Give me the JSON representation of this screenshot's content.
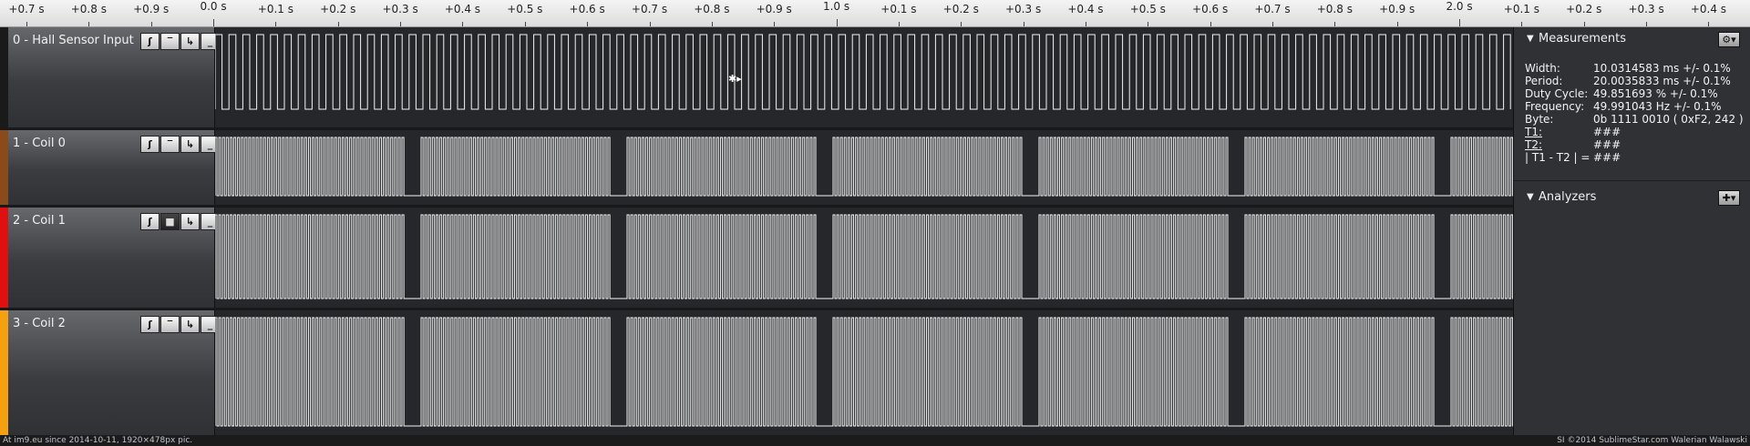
{
  "ruler": {
    "ticks": [
      "+0.7 s",
      "+0.8 s",
      "+0.9 s",
      "0.0 s",
      "+0.1 s",
      "+0.2 s",
      "+0.3 s",
      "+0.4 s",
      "+0.5 s",
      "+0.6 s",
      "+0.7 s",
      "+0.8 s",
      "+0.9 s",
      "1.0 s",
      "+0.1 s",
      "+0.2 s",
      "+0.3 s",
      "+0.4 s",
      "+0.5 s",
      "+0.6 s",
      "+0.7 s",
      "+0.8 s",
      "+0.9 s",
      "2.0 s",
      "+0.1 s",
      "+0.2 s",
      "+0.3 s",
      "+0.4 s"
    ],
    "major": [
      "0.0 s",
      "1.0 s",
      "2.0 s"
    ]
  },
  "channels": [
    {
      "name": "0 - Hall Sensor Input",
      "color": "#1a1a1a",
      "buttons": [
        "ʃ",
        "‾",
        "↳",
        "_"
      ],
      "signal": "clock"
    },
    {
      "name": "1 - Coil 0",
      "color": "#8b4a1a",
      "buttons": [
        "ʃ",
        "‾",
        "↳",
        "_"
      ],
      "signal": "pwm"
    },
    {
      "name": "2 - Coil 1",
      "color": "#e01010",
      "buttons": [
        "ʃ",
        "■",
        "↳",
        "_"
      ],
      "signal": "pwm"
    },
    {
      "name": "3 - Coil 2",
      "color": "#f5a10f",
      "buttons": [
        "ʃ",
        "‾",
        "↳",
        "_"
      ],
      "signal": "pwm"
    }
  ],
  "measurements": {
    "title": "Measurements",
    "gear_icon": "⚙▾",
    "rows": [
      {
        "k": "Width:",
        "v": "10.0314583 ms +/- 0.1%"
      },
      {
        "k": "Period:",
        "v": "20.0035833 ms +/- 0.1%"
      },
      {
        "k": "Duty Cycle:",
        "v": "49.851693 % +/- 0.1%"
      },
      {
        "k": "Frequency:",
        "v": "49.991043 Hz +/- 0.1%"
      },
      {
        "k": "Byte:",
        "v": "0b  1111  0010 ( 0xF2, 242 )"
      },
      {
        "k": "T1:",
        "v": "###"
      },
      {
        "k": "T2:",
        "v": "###"
      },
      {
        "k": "| T1 - T2 | =",
        "v": "###"
      }
    ]
  },
  "analyzers": {
    "title": "Analyzers",
    "add_icon": "✚▾"
  },
  "footer": {
    "left": "At im9.eu since 2014-10-11, 1920×478px pic.",
    "right": "SI ©2014 SublimeStar.com Walerian Walawski"
  },
  "cursor": "✱▸"
}
